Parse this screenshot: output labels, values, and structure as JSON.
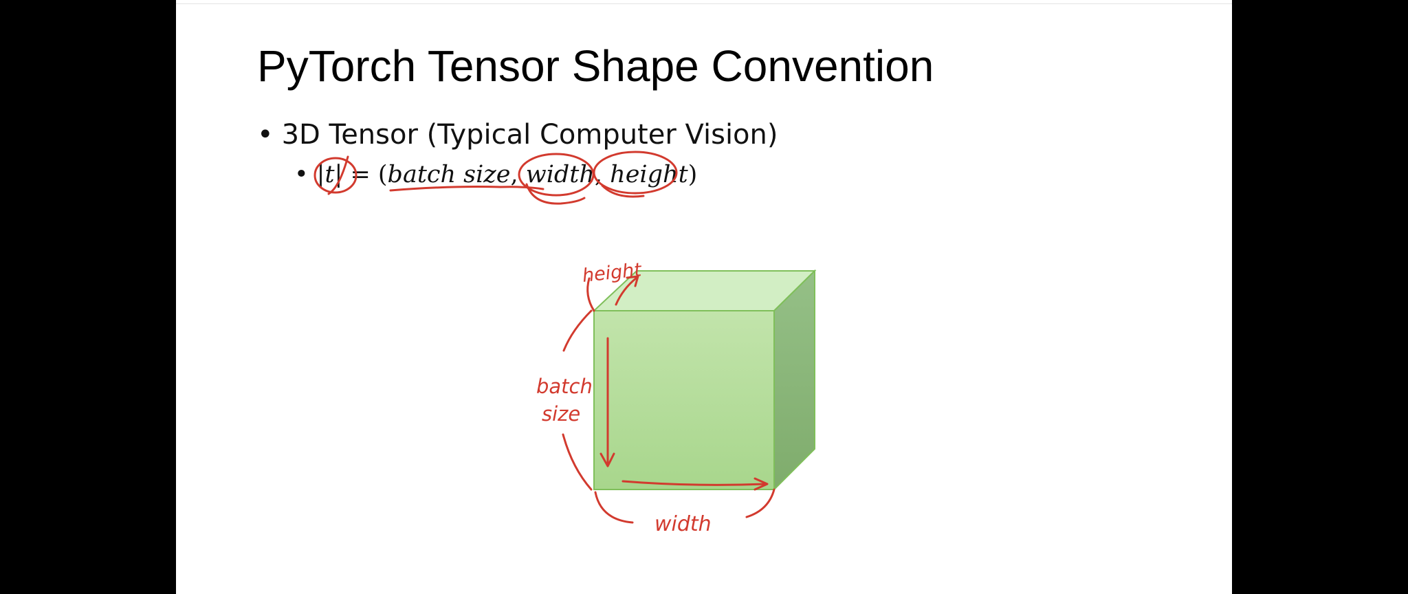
{
  "slide": {
    "title": "PyTorch Tensor Shape Convention",
    "bullet_1": "3D Tensor (Typical Computer Vision)",
    "formula": {
      "lhs": "|t|",
      "equals": " = (",
      "arg_1": "batch size",
      "sep": ", ",
      "arg_2": "width",
      "arg_3": "height",
      "close": ")"
    }
  },
  "annotations": {
    "height": "height",
    "batch": "batch",
    "size": "size",
    "width": "width"
  },
  "colors": {
    "ink": "#d23a2e",
    "cube_front": "#b3dc96",
    "cube_top": "#d2eec4",
    "cube_side": "#8ab67a",
    "cube_edge": "#7fbf5a"
  }
}
